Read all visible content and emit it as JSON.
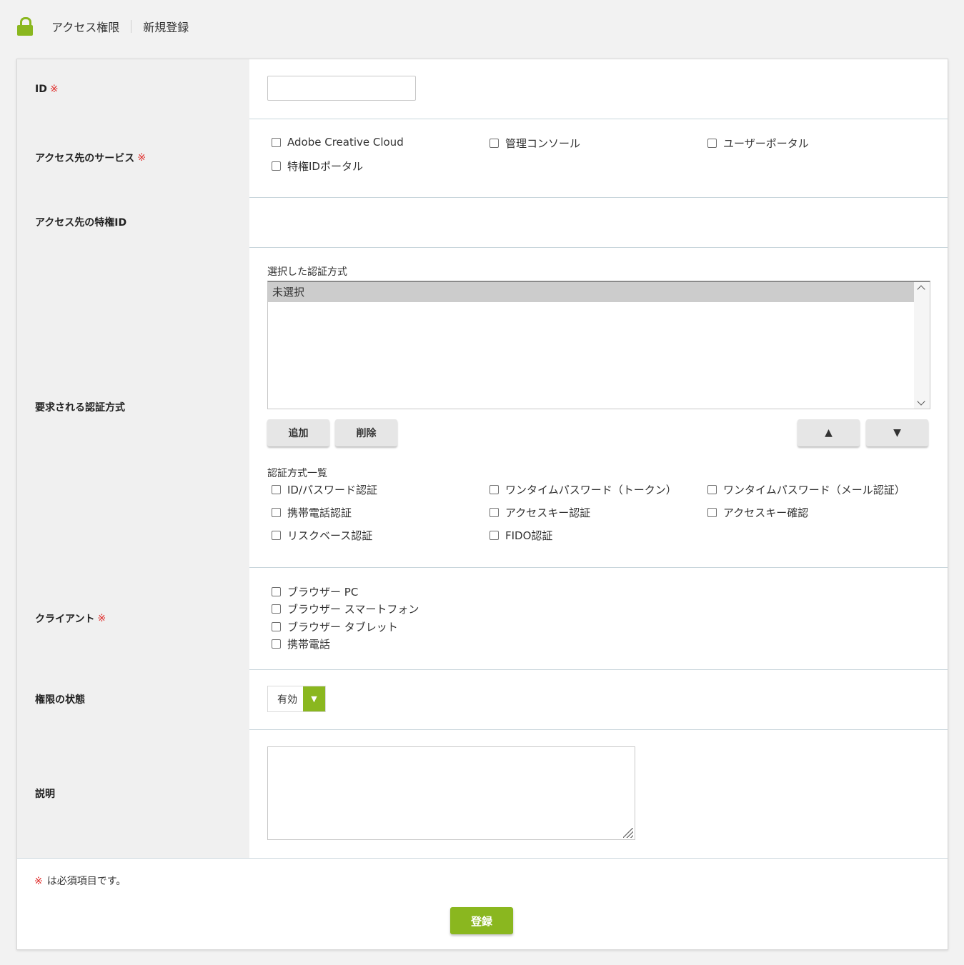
{
  "header": {
    "breadcrumb": [
      "アクセス権限",
      "新規登録"
    ]
  },
  "required_mark": "※",
  "rows": {
    "id": {
      "label": "ID",
      "value": ""
    },
    "services": {
      "label": "アクセス先のサービス",
      "options": [
        "Adobe Creative Cloud",
        "管理コンソール",
        "ユーザーポータル",
        "特権IDポータル"
      ]
    },
    "privileged_id": {
      "label": "アクセス先の特権ID"
    },
    "auth": {
      "label": "要求される認証方式",
      "selected_label": "選択した認証方式",
      "selected_items": [
        "未選択"
      ],
      "add_button": "追加",
      "delete_button": "削除",
      "up_button": "▲",
      "down_button": "▼",
      "list_label": "認証方式一覧",
      "methods": [
        "ID/パスワード認証",
        "ワンタイムパスワード（トークン）",
        "ワンタイムパスワード（メール認証）",
        "携帯電話認証",
        "アクセスキー認証",
        "アクセスキー確認",
        "リスクベース認証",
        "FIDO認証"
      ]
    },
    "client": {
      "label": "クライアント",
      "options": [
        "ブラウザー PC",
        "ブラウザー スマートフォン",
        "ブラウザー タブレット",
        "携帯電話"
      ]
    },
    "status": {
      "label": "権限の状態",
      "value": "有効",
      "arrow_icon": "triangle-down-icon"
    },
    "description": {
      "label": "説明",
      "value": ""
    }
  },
  "footer": {
    "required_note": "は必須項目です。",
    "submit_label": "登録"
  },
  "colors": {
    "accent": "#8ab71f",
    "required": "#e0312f",
    "label_bg": "#f0f0f0"
  }
}
